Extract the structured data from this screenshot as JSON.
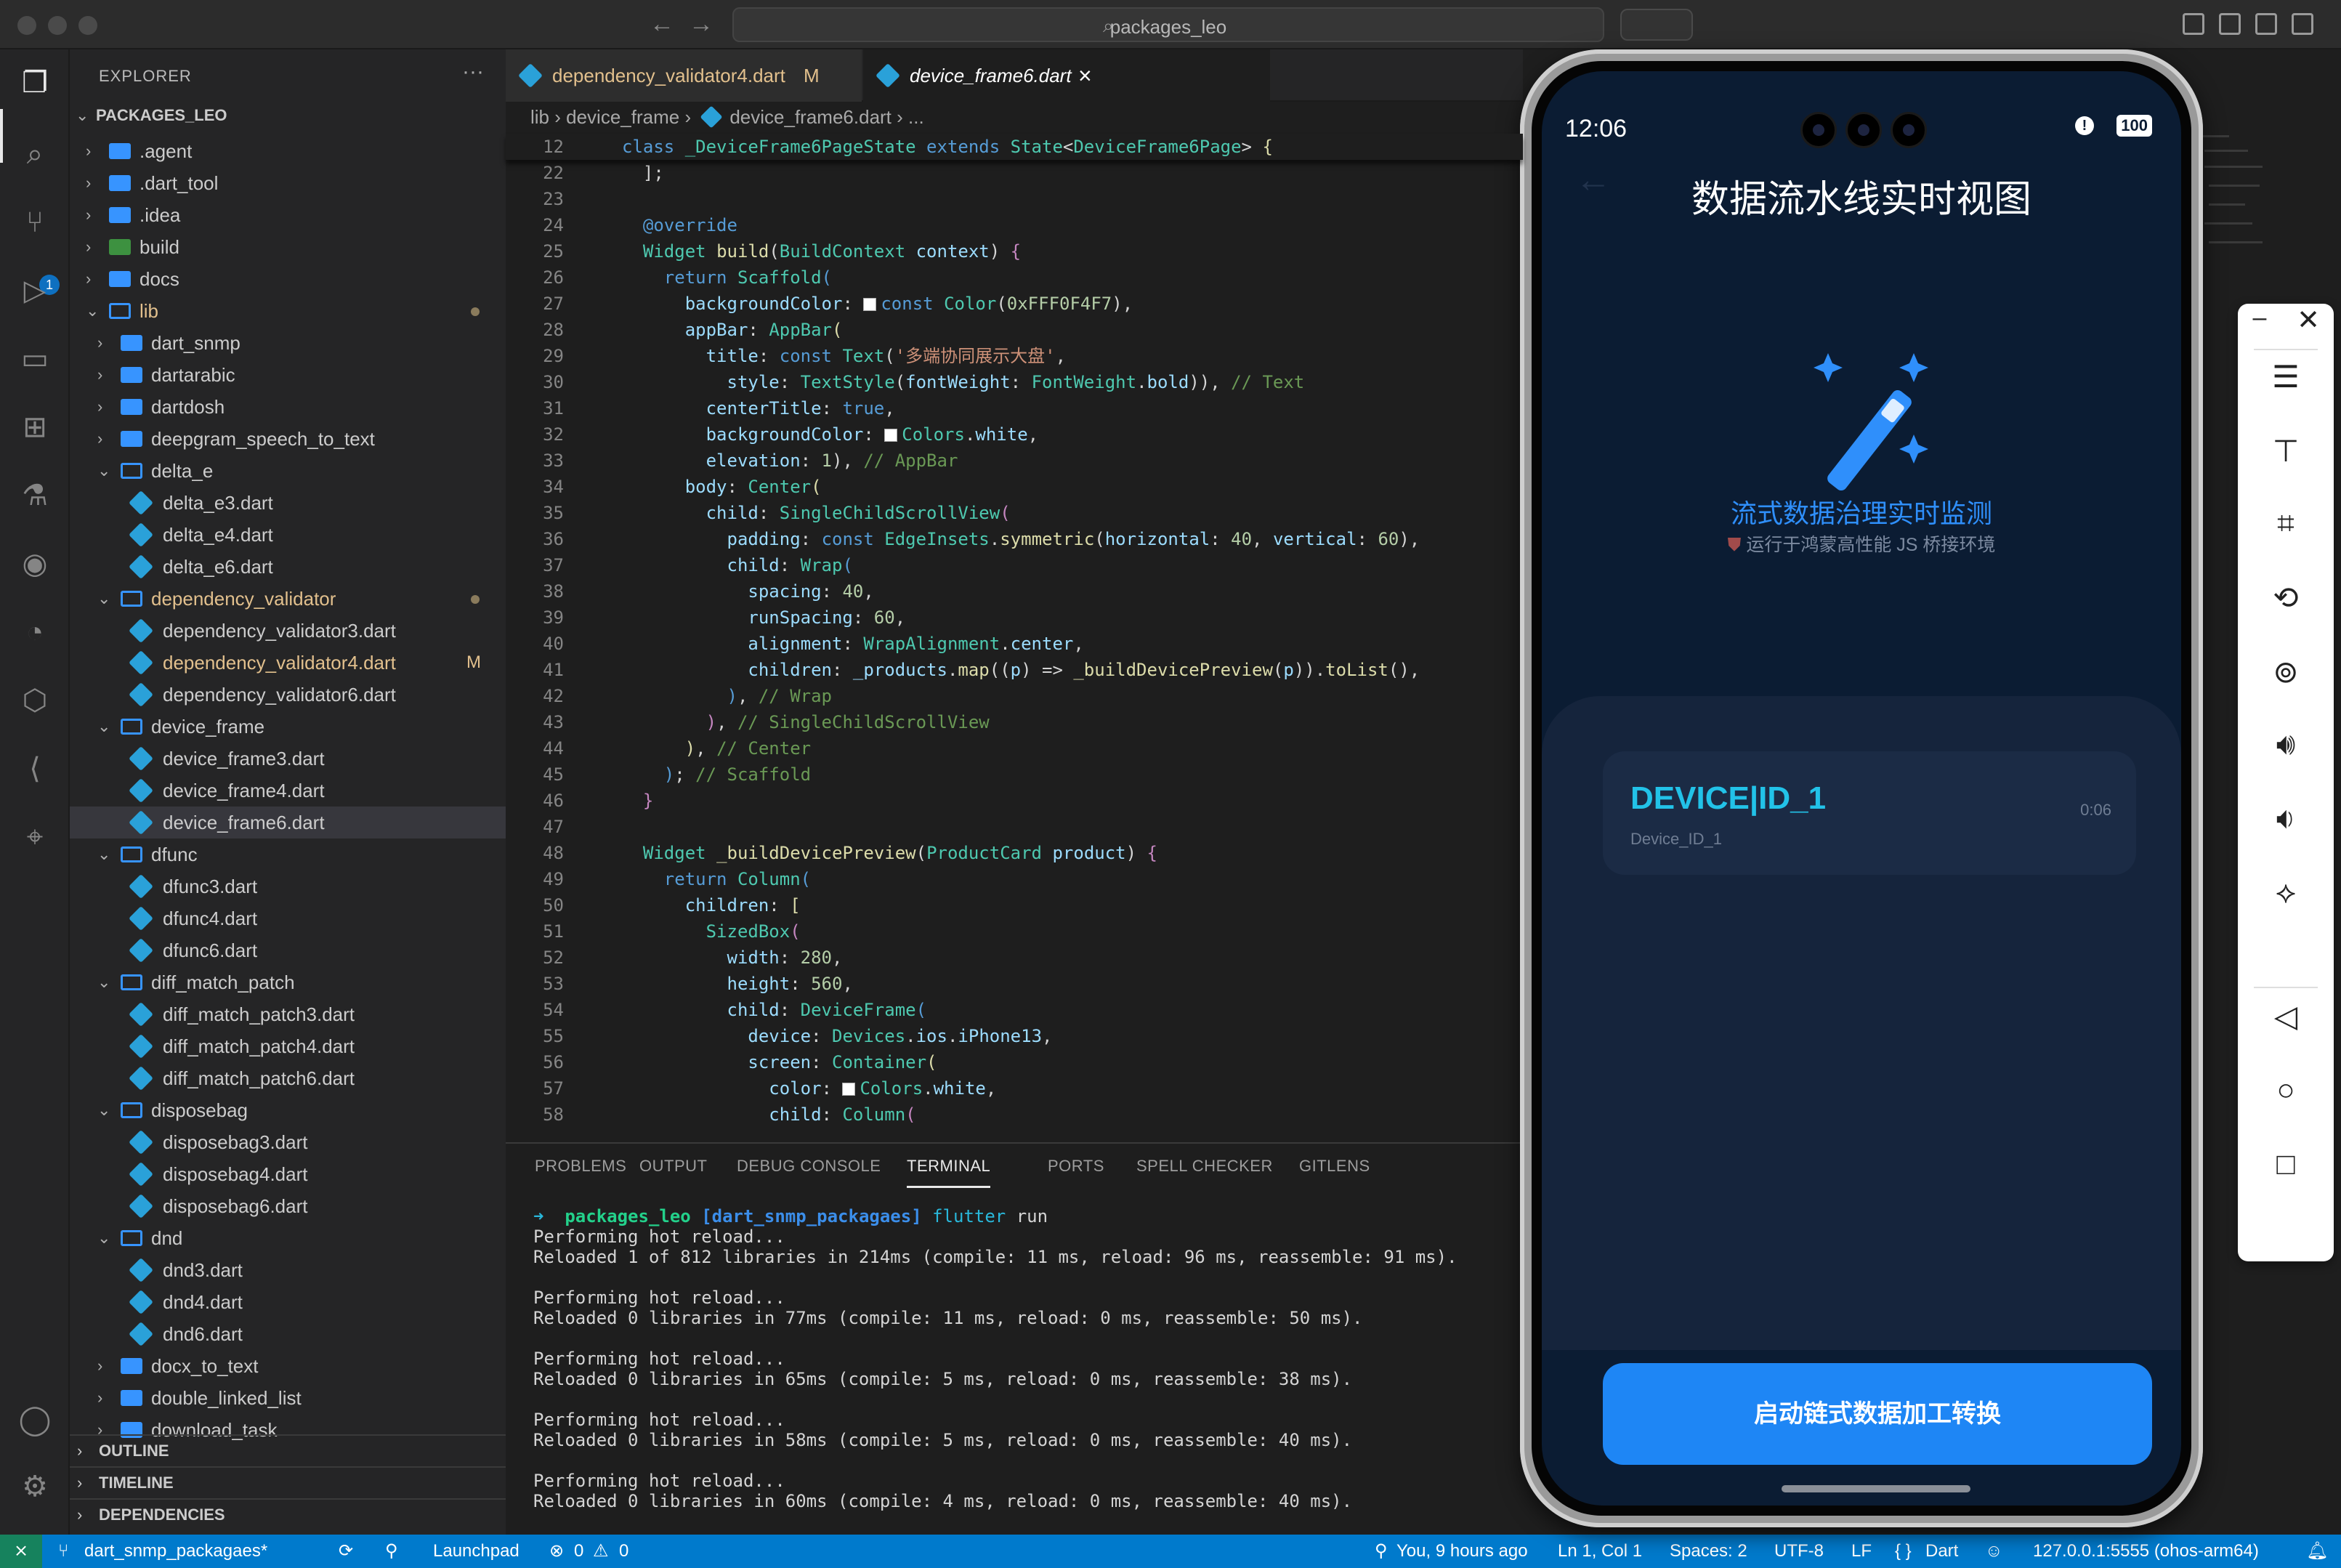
{
  "window": {
    "search": "packages_leo"
  },
  "explorer": {
    "title": "EXPLORER",
    "root": "PACKAGES_LEO",
    "badge": "1",
    "items": [
      {
        "label": ".agent",
        "depth": 0,
        "kind": "folder"
      },
      {
        "label": ".dart_tool",
        "depth": 0,
        "kind": "folder"
      },
      {
        "label": ".idea",
        "depth": 0,
        "kind": "folder"
      },
      {
        "label": "build",
        "depth": 0,
        "kind": "build"
      },
      {
        "label": "docs",
        "depth": 0,
        "kind": "folder"
      },
      {
        "label": "lib",
        "depth": 0,
        "kind": "open",
        "mod": true,
        "dot": true
      },
      {
        "label": "dart_snmp",
        "depth": 1,
        "kind": "folder"
      },
      {
        "label": "dartarabic",
        "depth": 1,
        "kind": "folder"
      },
      {
        "label": "dartdosh",
        "depth": 1,
        "kind": "folder"
      },
      {
        "label": "deepgram_speech_to_text",
        "depth": 1,
        "kind": "folder"
      },
      {
        "label": "delta_e",
        "depth": 1,
        "kind": "open"
      },
      {
        "label": "delta_e3.dart",
        "depth": 2,
        "kind": "dart"
      },
      {
        "label": "delta_e4.dart",
        "depth": 2,
        "kind": "dart"
      },
      {
        "label": "delta_e6.dart",
        "depth": 2,
        "kind": "dart"
      },
      {
        "label": "dependency_validator",
        "depth": 1,
        "kind": "open",
        "mod": true,
        "dot": true
      },
      {
        "label": "dependency_validator3.dart",
        "depth": 2,
        "kind": "dart"
      },
      {
        "label": "dependency_validator4.dart",
        "depth": 2,
        "kind": "dart",
        "mod": true,
        "flag": "M"
      },
      {
        "label": "dependency_validator6.dart",
        "depth": 2,
        "kind": "dart"
      },
      {
        "label": "device_frame",
        "depth": 1,
        "kind": "open"
      },
      {
        "label": "device_frame3.dart",
        "depth": 2,
        "kind": "dart"
      },
      {
        "label": "device_frame4.dart",
        "depth": 2,
        "kind": "dart"
      },
      {
        "label": "device_frame6.dart",
        "depth": 2,
        "kind": "dart",
        "selected": true
      },
      {
        "label": "dfunc",
        "depth": 1,
        "kind": "open"
      },
      {
        "label": "dfunc3.dart",
        "depth": 2,
        "kind": "dart"
      },
      {
        "label": "dfunc4.dart",
        "depth": 2,
        "kind": "dart"
      },
      {
        "label": "dfunc6.dart",
        "depth": 2,
        "kind": "dart"
      },
      {
        "label": "diff_match_patch",
        "depth": 1,
        "kind": "open"
      },
      {
        "label": "diff_match_patch3.dart",
        "depth": 2,
        "kind": "dart"
      },
      {
        "label": "diff_match_patch4.dart",
        "depth": 2,
        "kind": "dart"
      },
      {
        "label": "diff_match_patch6.dart",
        "depth": 2,
        "kind": "dart"
      },
      {
        "label": "disposebag",
        "depth": 1,
        "kind": "open"
      },
      {
        "label": "disposebag3.dart",
        "depth": 2,
        "kind": "dart"
      },
      {
        "label": "disposebag4.dart",
        "depth": 2,
        "kind": "dart"
      },
      {
        "label": "disposebag6.dart",
        "depth": 2,
        "kind": "dart"
      },
      {
        "label": "dnd",
        "depth": 1,
        "kind": "open"
      },
      {
        "label": "dnd3.dart",
        "depth": 2,
        "kind": "dart"
      },
      {
        "label": "dnd4.dart",
        "depth": 2,
        "kind": "dart"
      },
      {
        "label": "dnd6.dart",
        "depth": 2,
        "kind": "dart"
      },
      {
        "label": "docx_to_text",
        "depth": 1,
        "kind": "folder"
      },
      {
        "label": "double_linked_list",
        "depth": 1,
        "kind": "folder"
      },
      {
        "label": "download_task",
        "depth": 1,
        "kind": "folder"
      }
    ],
    "sections": [
      "OUTLINE",
      "TIMELINE",
      "DEPENDENCIES"
    ]
  },
  "editor": {
    "tabs": [
      {
        "label": "dependency_validator4.dart",
        "flag": "M"
      },
      {
        "label": "device_frame6.dart",
        "close": "×"
      }
    ],
    "breadcrumb": {
      "a": "lib",
      "b": "device_frame",
      "c": "device_frame6.dart",
      "d": "..."
    },
    "sticky": {
      "ln": "12",
      "html": "<span class=\"kw\">class</span> <span class=\"ty\">_DeviceFrame6PageState</span> <span class=\"kw\">extends</span> <span class=\"ty\">State</span>&lt;<span class=\"ty\">DeviceFrame6Page</span>&gt; <span class=\"an\">{</span>"
    },
    "lines": [
      {
        "ln": "22",
        "html": "  ];"
      },
      {
        "ln": "23",
        "html": ""
      },
      {
        "ln": "24",
        "html": "  <span class=\"kw\">@override</span>"
      },
      {
        "ln": "25",
        "html": "  <span class=\"ty\">Widget</span> <span class=\"fn\">build</span>(<span class=\"ty\">BuildContext</span> <span class=\"pr\">context</span>) <span class=\"pu\">{</span>"
      },
      {
        "ln": "26",
        "html": "    <span class=\"kw\">return</span> <span class=\"ty\">Scaffold</span><span class=\"kw\">(</span>"
      },
      {
        "ln": "27",
        "html": "      <span class=\"pr\">backgroundColor</span>: <span class=\"sw\"></span><span class=\"kw\">const</span> <span class=\"ty\">Color</span>(<span class=\"nu\">0xFFF0F4F7</span>),"
      },
      {
        "ln": "28",
        "html": "      <span class=\"pr\">appBar</span>: <span class=\"ty\">AppBar</span><span class=\"an\">(</span>"
      },
      {
        "ln": "29",
        "html": "        <span class=\"pr\">title</span>: <span class=\"kw\">const</span> <span class=\"ty\">Text</span>(<span class=\"st\">'多端协同展示大盘'</span>,"
      },
      {
        "ln": "30",
        "html": "          <span class=\"pr\">style</span>: <span class=\"ty\">TextStyle</span>(<span class=\"pr\">fontWeight</span>: <span class=\"ty\">FontWeight</span>.<span class=\"pr\">bold</span>)), <span class=\"cm\">// Text</span>"
      },
      {
        "ln": "31",
        "html": "        <span class=\"pr\">centerTitle</span>: <span class=\"kw\">true</span>,"
      },
      {
        "ln": "32",
        "html": "        <span class=\"pr\">backgroundColor</span>: <span class=\"sw\"></span><span class=\"ty\">Colors</span>.<span class=\"pr\">white</span>,"
      },
      {
        "ln": "33",
        "html": "        <span class=\"pr\">elevation</span>: <span class=\"nu\">1</span>), <span class=\"cm\">// AppBar</span>"
      },
      {
        "ln": "34",
        "html": "      <span class=\"pr\">body</span>: <span class=\"ty\">Center</span><span class=\"an\">(</span>"
      },
      {
        "ln": "35",
        "html": "        <span class=\"pr\">child</span>: <span class=\"ty\">SingleChildScrollView</span><span class=\"pu\">(</span>"
      },
      {
        "ln": "36",
        "html": "          <span class=\"pr\">padding</span>: <span class=\"kw\">const</span> <span class=\"ty\">EdgeInsets</span>.<span class=\"fn\">symmetric</span>(<span class=\"pr\">horizontal</span>: <span class=\"nu\">40</span>, <span class=\"pr\">vertical</span>: <span class=\"nu\">60</span>),"
      },
      {
        "ln": "37",
        "html": "          <span class=\"pr\">child</span>: <span class=\"ty\">Wrap</span><span class=\"kw\">(</span>"
      },
      {
        "ln": "38",
        "html": "            <span class=\"pr\">spacing</span>: <span class=\"nu\">40</span>,"
      },
      {
        "ln": "39",
        "html": "            <span class=\"pr\">runSpacing</span>: <span class=\"nu\">60</span>,"
      },
      {
        "ln": "40",
        "html": "            <span class=\"pr\">alignment</span>: <span class=\"ty\">WrapAlignment</span>.<span class=\"pr\">center</span>,"
      },
      {
        "ln": "41",
        "html": "            <span class=\"pr\">children</span>: <span class=\"pr\">_products</span>.<span class=\"fn\">map</span>((<span class=\"pr\">p</span>) =&gt; <span class=\"fn\">_buildDevicePreview</span>(<span class=\"pr\">p</span>)).<span class=\"fn\">toList</span>(),"
      },
      {
        "ln": "42",
        "html": "          <span class=\"kw\">)</span>, <span class=\"cm\">// Wrap</span>"
      },
      {
        "ln": "43",
        "html": "        <span class=\"pu\">)</span>, <span class=\"cm\">// SingleChildScrollView</span>"
      },
      {
        "ln": "44",
        "html": "      <span class=\"an\">)</span>, <span class=\"cm\">// Center</span>"
      },
      {
        "ln": "45",
        "html": "    <span class=\"kw\">)</span>; <span class=\"cm\">// Scaffold</span>"
      },
      {
        "ln": "46",
        "html": "  <span class=\"pu\">}</span>"
      },
      {
        "ln": "47",
        "html": ""
      },
      {
        "ln": "48",
        "html": "  <span class=\"ty\">Widget</span> <span class=\"fn\">_buildDevicePreview</span>(<span class=\"ty\">ProductCard</span> <span class=\"pr\">product</span>) <span class=\"pu\">{</span>"
      },
      {
        "ln": "49",
        "html": "    <span class=\"kw\">return</span> <span class=\"ty\">Column</span><span class=\"kw\">(</span>"
      },
      {
        "ln": "50",
        "html": "      <span class=\"pr\">children</span>: <span class=\"an\">[</span>"
      },
      {
        "ln": "51",
        "html": "        <span class=\"ty\">SizedBox</span><span class=\"pu\">(</span>"
      },
      {
        "ln": "52",
        "html": "          <span class=\"pr\">width</span>: <span class=\"nu\">280</span>,"
      },
      {
        "ln": "53",
        "html": "          <span class=\"pr\">height</span>: <span class=\"nu\">560</span>,"
      },
      {
        "ln": "54",
        "html": "          <span class=\"pr\">child</span>: <span class=\"ty\">DeviceFrame</span><span class=\"kw\">(</span>"
      },
      {
        "ln": "55",
        "html": "            <span class=\"pr\">device</span>: <span class=\"ty\">Devices</span>.<span class=\"pr\">ios</span>.<span class=\"pr\">iPhone13</span>,"
      },
      {
        "ln": "56",
        "html": "            <span class=\"pr\">screen</span>: <span class=\"ty\">Container</span><span class=\"an\">(</span>"
      },
      {
        "ln": "57",
        "html": "              <span class=\"pr\">color</span>: <span class=\"sw\"></span><span class=\"ty\">Colors</span>.<span class=\"pr\">white</span>,"
      },
      {
        "ln": "58",
        "html": "              <span class=\"pr\">child</span>: <span class=\"ty\">Column</span><span class=\"pu\">(</span>"
      }
    ]
  },
  "panel": {
    "tabs": [
      "PROBLEMS",
      "OUTPUT",
      "DEBUG CONSOLE",
      "TERMINAL",
      "PORTS",
      "SPELL CHECKER",
      "GITLENS"
    ],
    "active": "TERMINAL",
    "prompt": {
      "dir": "packages_leo",
      "branch": "[dart_snmp_packagaes]",
      "cmd": "flutter",
      "arg": "run"
    },
    "terminal": [
      "Performing hot reload...",
      "Reloaded 1 of 812 libraries in 214ms (compile: 11 ms, reload: 96 ms, reassemble: 91 ms).",
      "",
      "Performing hot reload...",
      "Reloaded 0 libraries in 77ms (compile: 11 ms, reload: 0 ms, reassemble: 50 ms).",
      "",
      "Performing hot reload...",
      "Reloaded 0 libraries in 65ms (compile: 5 ms, reload: 0 ms, reassemble: 38 ms).",
      "",
      "Performing hot reload...",
      "Reloaded 0 libraries in 58ms (compile: 5 ms, reload: 0 ms, reassemble: 40 ms).",
      "",
      "Performing hot reload...",
      "Reloaded 0 libraries in 60ms (compile: 4 ms, reload: 0 ms, reassemble: 40 ms)."
    ]
  },
  "status": {
    "branch": "dart_snmp_packagaes*",
    "launchpad": "Launchpad",
    "errors": "0",
    "warnings": "0",
    "blame": "You, 9 hours ago",
    "cursor": "Ln 1, Col 1",
    "spaces": "Spaces: 2",
    "encoding": "UTF-8",
    "eol": "LF",
    "language": "Dart",
    "device": "127.0.0.1:5555 (ohos-arm64)"
  },
  "phone": {
    "time": "12:06",
    "battery": "100",
    "title": "数据流水线实时视图",
    "subtitle": "流式数据治理实时监测",
    "caption": "运行于鸿蒙高性能 JS 桥接环境",
    "card": {
      "id": "DEVICE|ID_1",
      "sub": "Device_ID_1",
      "time": "0:06"
    },
    "button": "启动链式数据加工转换"
  },
  "colors": {
    "accent": "#007acc",
    "phone_bg": "#0b1c33",
    "button": "#1e86f5",
    "device_id": "#22c2e8"
  }
}
